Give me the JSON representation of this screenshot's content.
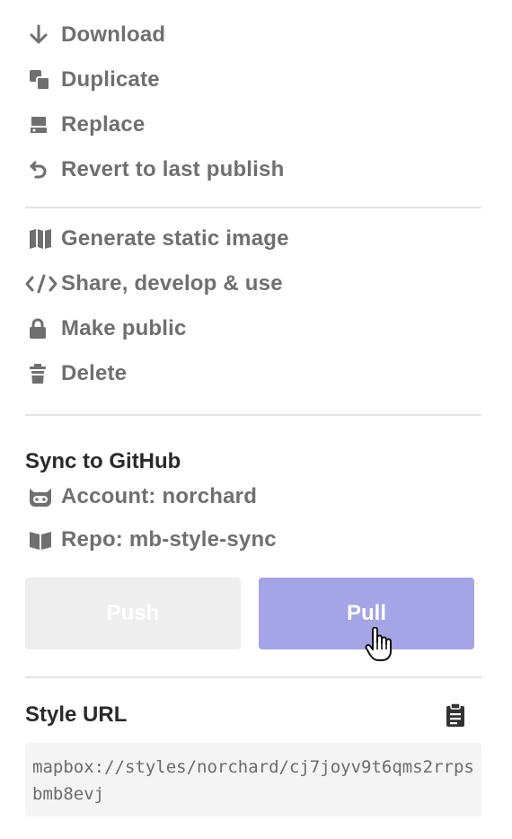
{
  "menu_primary": {
    "items": [
      {
        "label": "Download",
        "icon": "download-icon"
      },
      {
        "label": "Duplicate",
        "icon": "duplicate-icon"
      },
      {
        "label": "Replace",
        "icon": "replace-icon"
      },
      {
        "label": "Revert to last publish",
        "icon": "revert-icon"
      }
    ]
  },
  "menu_secondary": {
    "items": [
      {
        "label": "Generate static image",
        "icon": "map-icon"
      },
      {
        "label": "Share, develop & use",
        "icon": "code-icon"
      },
      {
        "label": "Make public",
        "icon": "lock-icon"
      },
      {
        "label": "Delete",
        "icon": "trash-icon"
      }
    ]
  },
  "sync": {
    "title": "Sync to GitHub",
    "account": {
      "label": "Account: norchard",
      "icon": "octocat-icon"
    },
    "repo": {
      "label": "Repo: mb-style-sync",
      "icon": "book-icon"
    },
    "push_label": "Push",
    "pull_label": "Pull"
  },
  "style_url": {
    "title": "Style URL",
    "value": "mapbox://styles/norchard/cj7joyv9t6qms2rrpsbmb8evj",
    "copy_icon": "clipboard-icon"
  },
  "colors": {
    "text_muted": "#6f6f6f",
    "text_heading": "#2a2a2a",
    "divider": "#e3e3e3",
    "pull_button": "#a4a4e6",
    "push_button": "#eeeeee",
    "url_bg": "#f4f4f4"
  }
}
